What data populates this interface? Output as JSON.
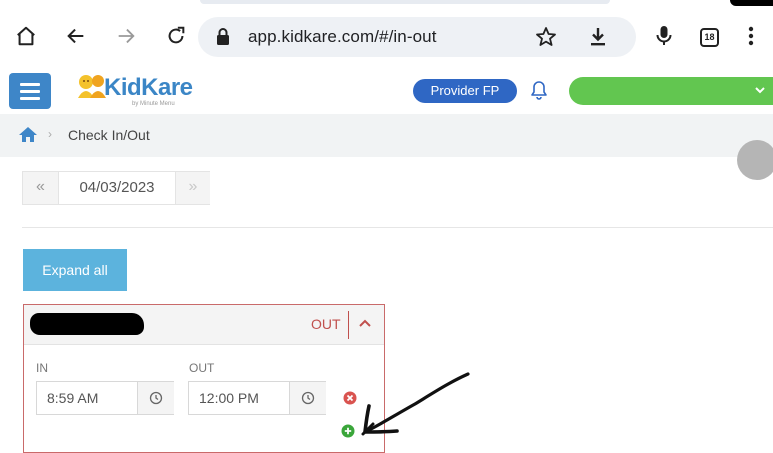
{
  "browser": {
    "url": "app.kidkare.com/#/in-out",
    "tab_count": "18"
  },
  "header": {
    "logo_text": "KidKare",
    "logo_subtext": "by Minute Menu",
    "provider_label": "Provider FP"
  },
  "breadcrumb": {
    "separator": "›",
    "current": "Check In/Out"
  },
  "date_nav": {
    "prev_symbol": "«",
    "date": "04/03/2023",
    "next_symbol": "»"
  },
  "expand_all_label": "Expand all",
  "card": {
    "status": "OUT",
    "in_label": "IN",
    "in_value": "8:59 AM",
    "out_label": "OUT",
    "out_value": "12:00 PM"
  },
  "colors": {
    "menu_button": "#3e86c8",
    "provider_button": "#2f67c4",
    "account_bar": "#62c650",
    "expand_button": "#5cb3dd",
    "card_border": "#c96a6a",
    "remove_icon": "#d9534f",
    "add_icon": "#3aa63a"
  },
  "icons": [
    "home-icon",
    "back-arrow-icon",
    "forward-arrow-icon",
    "reload-icon",
    "lock-icon",
    "star-icon",
    "download-icon",
    "mic-icon",
    "menu-dots-icon",
    "bell-icon",
    "chevron-down-icon",
    "chevron-up-icon",
    "clock-icon",
    "remove-circle-icon",
    "add-circle-icon"
  ]
}
